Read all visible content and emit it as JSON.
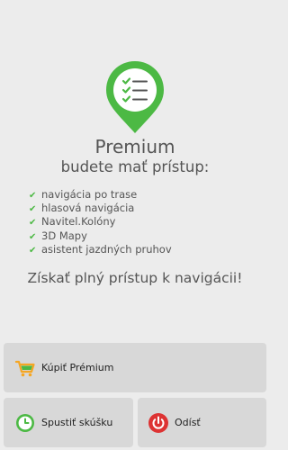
{
  "header": {
    "icon": "checklist-map-pin-icon",
    "title": "Premium",
    "subtitle": "budete mať prístup:"
  },
  "features": [
    "navigácia po trase",
    "hlasová navigácia",
    "Navitel.Kolóny",
    "3D Mapy",
    "asistent jazdných pruhov"
  ],
  "promo_text": "Získať plný prístup k navigácii!",
  "buttons": {
    "buy": {
      "label": "Kúpiť Prémium",
      "icon": "shopping-cart-icon"
    },
    "trial": {
      "label": "Spustiť skúšku",
      "icon": "clock-icon"
    },
    "quit": {
      "label": "Odísť",
      "icon": "power-icon"
    }
  },
  "colors": {
    "accent_green": "#4cb944",
    "quit_red": "#d33",
    "cart_orange": "#f5a623",
    "background": "#ececec",
    "button_bg": "#d8d8d8"
  }
}
